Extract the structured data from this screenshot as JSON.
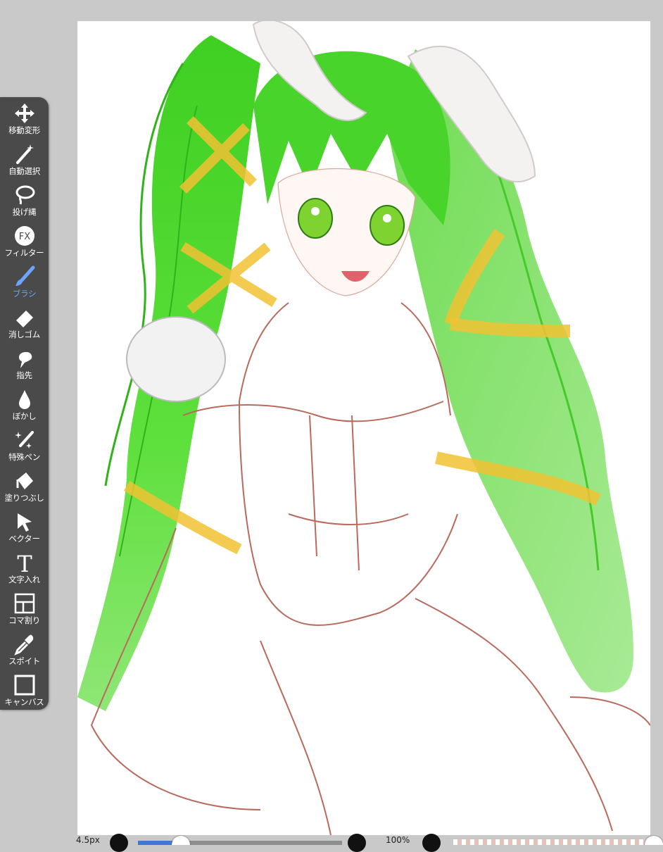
{
  "toolbar": {
    "tools": [
      {
        "label": "移動変形",
        "icon": "move-arrows-icon",
        "active": false
      },
      {
        "label": "自動選択",
        "icon": "magic-wand-icon",
        "active": false
      },
      {
        "label": "投げ縄",
        "icon": "lasso-icon",
        "active": false
      },
      {
        "label": "フィルター",
        "icon": "fx-filter-icon",
        "active": false,
        "icon_text": "FX"
      },
      {
        "label": "ブラシ",
        "icon": "brush-icon",
        "active": true
      },
      {
        "label": "消しゴム",
        "icon": "eraser-icon",
        "active": false
      },
      {
        "label": "指先",
        "icon": "smudge-finger-icon",
        "active": false
      },
      {
        "label": "ぼかし",
        "icon": "blur-drop-icon",
        "active": false
      },
      {
        "label": "特殊ペン",
        "icon": "special-pen-icon",
        "active": false
      },
      {
        "label": "塗りつぶし",
        "icon": "bucket-fill-icon",
        "active": false
      },
      {
        "label": "ベクター",
        "icon": "vector-cursor-icon",
        "active": false
      },
      {
        "label": "文字入れ",
        "icon": "text-tool-icon",
        "active": false,
        "icon_text": "T"
      },
      {
        "label": "コマ割り",
        "icon": "panel-divide-icon",
        "active": false
      },
      {
        "label": "スポイト",
        "icon": "eyedropper-icon",
        "active": false
      },
      {
        "label": "キャンバス",
        "icon": "canvas-icon",
        "active": false
      }
    ]
  },
  "bottom_bar": {
    "brush_size": "4.5px",
    "opacity": "100%",
    "brush_size_slider_level": 0.18,
    "opacity_slider_level": 1.0
  },
  "colors": {
    "toolbar_bg": "#4a4a4a",
    "active_tool": "#6aa6ff",
    "hair_green": "#59d63a",
    "ribbon_yellow": "#f1c232",
    "lineart": "#b96a5c"
  }
}
